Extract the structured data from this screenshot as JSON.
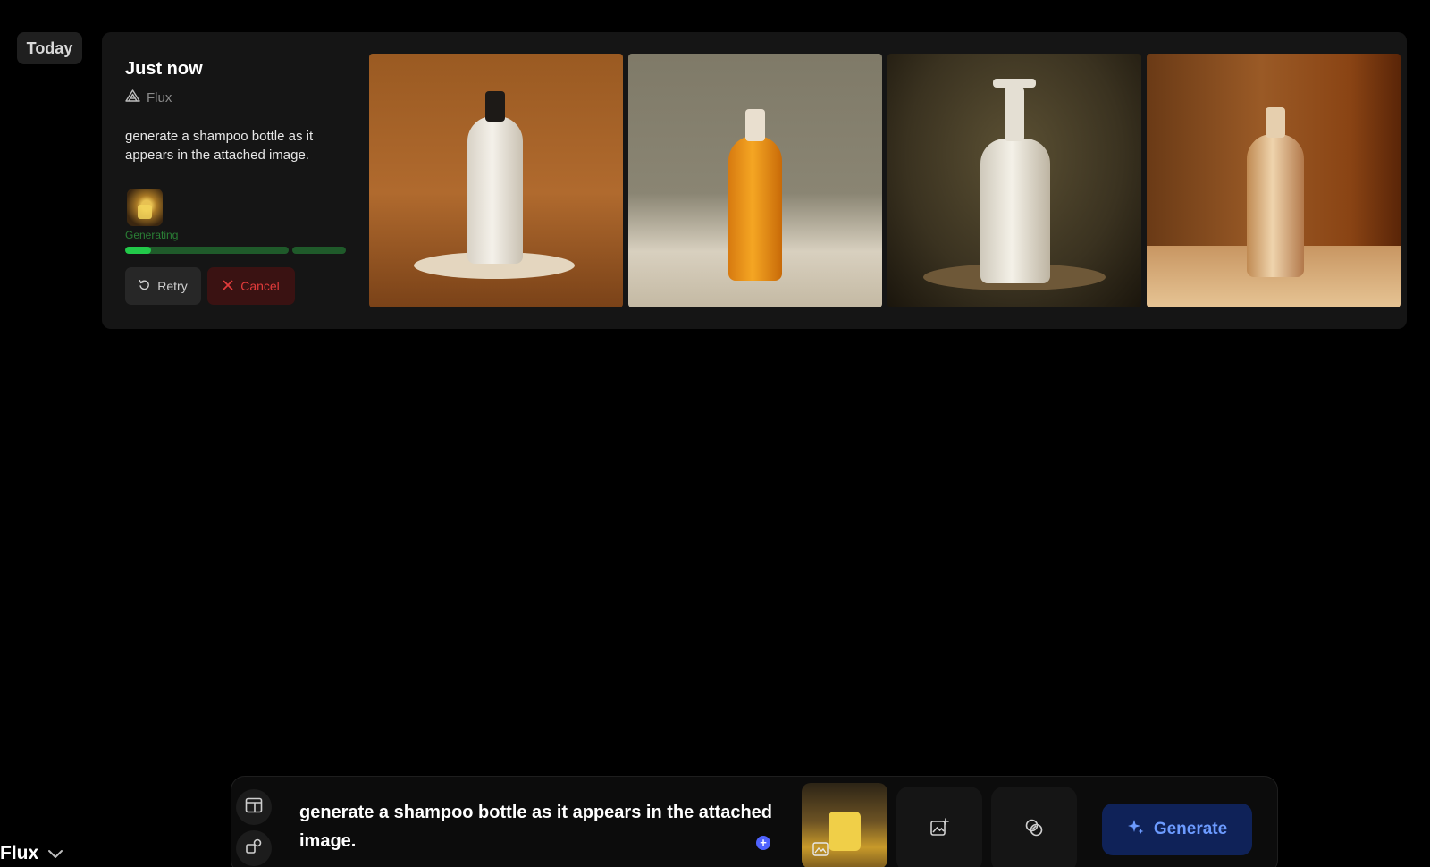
{
  "history": {
    "section_label": "Today"
  },
  "card": {
    "time": "Just now",
    "model": "Flux",
    "prompt": "generate a shampoo bottle as it appears in the attached image.",
    "status": "Generating",
    "progress": 0.16,
    "retry_label": "Retry",
    "cancel_label": "Cancel"
  },
  "composer": {
    "prompt": "generate a shampoo bottle as it appears in the attached image.",
    "generate_label": "Generate",
    "model": "Flux",
    "accent": "#4f63ff"
  },
  "colors": {
    "progress_fill": "#22c94a",
    "progress_track": "#1f5a2a",
    "cancel_text": "#e23b3b",
    "generate_bg": "#0f2258",
    "generate_text": "#6c9bff"
  },
  "icons": [
    "flux-logo-icon",
    "retry-icon",
    "close-icon",
    "layout-icon",
    "shapes-icon",
    "add-image-icon",
    "overlap-circles-icon",
    "sparkles-icon",
    "chevron-down-icon",
    "plus-icon"
  ]
}
